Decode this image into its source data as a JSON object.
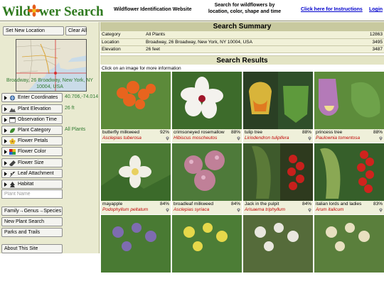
{
  "header": {
    "logo_text": "Wildflower Search",
    "tagline": "Wildflower Identification Website",
    "blurb": "Search for wildflowers by location, color, shape and time",
    "instructions_link": "Click here for Instructions",
    "login_link": "Login"
  },
  "sidebar": {
    "set_location": "Set New Location",
    "clear_all": "Clear All",
    "location_text": "Broadway, 26 Broadway, New York, NY 10004, USA",
    "params": [
      {
        "label": "Enter Coordinates",
        "value": "40.706,-74.014",
        "icon": "globe-icon"
      },
      {
        "label": "Plant Elevation",
        "value": "26 ft",
        "icon": "elevation-icon"
      },
      {
        "label": "Observation Time",
        "value": "",
        "icon": "calendar-icon"
      },
      {
        "label": "Plant Category",
        "value": "All Plants",
        "icon": "leaf-icon"
      },
      {
        "label": "Flower Petals",
        "value": "",
        "icon": "petals-icon"
      },
      {
        "label": "Flower Color",
        "value": "",
        "icon": "palette-icon"
      },
      {
        "label": "Flower Size",
        "value": "",
        "icon": "ruler-icon"
      },
      {
        "label": "Leaf Attachment",
        "value": "",
        "icon": "leaf-attach-icon"
      },
      {
        "label": "Habitat",
        "value": "",
        "icon": "habitat-icon"
      }
    ],
    "plant_name_placeholder": "Plant Name",
    "nav": [
      "Family→Genus→Species",
      "New Plant Search",
      "Parks and Trails",
      "About This Site"
    ]
  },
  "summary": {
    "title": "Search Summary",
    "rows": [
      {
        "key": "Category",
        "value": "All Plants",
        "count": "12863"
      },
      {
        "key": "Location",
        "value": "Broadway, 26 Broadway, New York, NY 10004, USA",
        "count": "3495"
      },
      {
        "key": "Elevation",
        "value": "26 feet",
        "count": "3487"
      }
    ]
  },
  "results": {
    "title": "Search Results",
    "hint": "Click on an image for more information",
    "cards": [
      {
        "name": "butterfly milkweed",
        "pct": "92%",
        "sci": "Asclepias tuberosa",
        "colors": [
          "#e8641e",
          "#5c8a3a"
        ]
      },
      {
        "name": "crimsoneyed rosemallow",
        "pct": "88%",
        "sci": "Hibiscus moscheutos",
        "colors": [
          "#f4f2ee",
          "#3d6b2b"
        ]
      },
      {
        "name": "tulip tree",
        "pct": "88%",
        "sci": "Liriodendron tulipifera",
        "colors": [
          "#d8b43a",
          "#2f4f2a"
        ]
      },
      {
        "name": "princess tree",
        "pct": "88%",
        "sci": "Paulownia tomentosa",
        "colors": [
          "#b47ab8",
          "#5d8c3b"
        ]
      },
      {
        "name": "mayapple",
        "pct": "84%",
        "sci": "Podophyllum peltatum",
        "colors": [
          "#f1efe6",
          "#4b7a34"
        ]
      },
      {
        "name": "broadleaf milkweed",
        "pct": "84%",
        "sci": "Asclepias syriaca",
        "colors": [
          "#c08098",
          "#4e7a3a"
        ]
      },
      {
        "name": "Jack in the pulpit",
        "pct": "84%",
        "sci": "Arisaema triphyllum",
        "colors": [
          "#3e5a2c",
          "#c8201c"
        ]
      },
      {
        "name": "italian lords and ladies",
        "pct": "83%",
        "sci": "Arum italicum",
        "colors": [
          "#365f2a",
          "#d0231d"
        ]
      },
      {
        "name": "",
        "pct": "",
        "sci": "",
        "colors": [
          "#7e6cb0",
          "#497a33"
        ]
      },
      {
        "name": "",
        "pct": "",
        "sci": "",
        "colors": [
          "#e6d84a",
          "#4c7d36"
        ]
      },
      {
        "name": "",
        "pct": "",
        "sci": "",
        "colors": [
          "#e9e7df",
          "#556b3a"
        ]
      },
      {
        "name": "",
        "pct": "",
        "sci": "",
        "colors": [
          "#e8e0c0",
          "#5a7f3c"
        ]
      }
    ]
  },
  "colors": {
    "sidebar_bg": "#e9ead0",
    "value_green": "#2f7a2f",
    "link_blue": "#0000cc",
    "sci_red": "#c00000"
  }
}
